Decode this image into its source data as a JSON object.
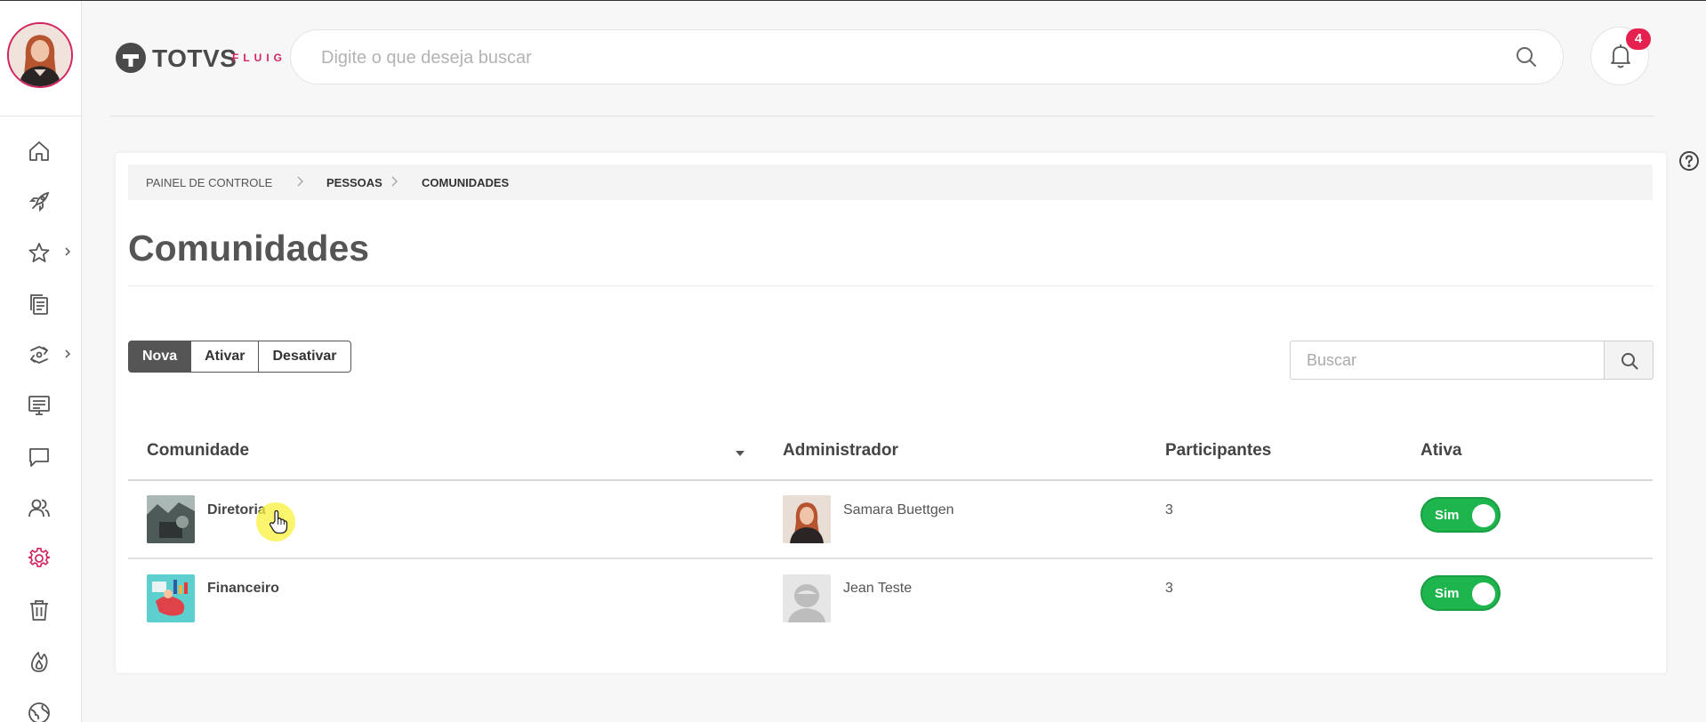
{
  "header": {
    "logo_text": "TOTVS",
    "logo_sub": "FLUIG",
    "search_placeholder": "Digite o que deseja buscar",
    "notification_count": "4"
  },
  "sidebar": {
    "items": [
      {
        "name": "home",
        "icon": "home-icon"
      },
      {
        "name": "rocket",
        "icon": "rocket-icon",
        "has_submenu": false
      },
      {
        "name": "favorites",
        "icon": "star-icon",
        "has_submenu": true
      },
      {
        "name": "documents",
        "icon": "documents-icon"
      },
      {
        "name": "processes",
        "icon": "processes-icon",
        "has_submenu": true
      },
      {
        "name": "presentation",
        "icon": "monitor-icon"
      },
      {
        "name": "messages",
        "icon": "chat-icon"
      },
      {
        "name": "people",
        "icon": "people-icon"
      },
      {
        "name": "settings",
        "icon": "gear-icon",
        "active": true
      },
      {
        "name": "trash",
        "icon": "trash-icon"
      },
      {
        "name": "fire",
        "icon": "fire-icon"
      },
      {
        "name": "globe",
        "icon": "globe-icon"
      }
    ],
    "active_color": "#d3245f"
  },
  "breadcrumb": [
    "PAINEL DE CONTROLE",
    "PESSOAS",
    "COMUNIDADES"
  ],
  "page": {
    "title": "Comunidades"
  },
  "actions": {
    "new_label": "Nova",
    "activate_label": "Ativar",
    "deactivate_label": "Desativar"
  },
  "table_search": {
    "placeholder": "Buscar"
  },
  "table": {
    "columns": [
      "Comunidade",
      "Administrador",
      "Participantes",
      "Ativa"
    ],
    "rows": [
      {
        "community": "Diretoria",
        "admin": "Samara Buettgen",
        "participants": "3",
        "active": "Sim"
      },
      {
        "community": "Financeiro",
        "admin": "Jean Teste",
        "participants": "3",
        "active": "Sim"
      }
    ]
  },
  "colors": {
    "toggle_on": "#1fb54e",
    "badge": "#e5224f",
    "primary_button": "#555555"
  }
}
